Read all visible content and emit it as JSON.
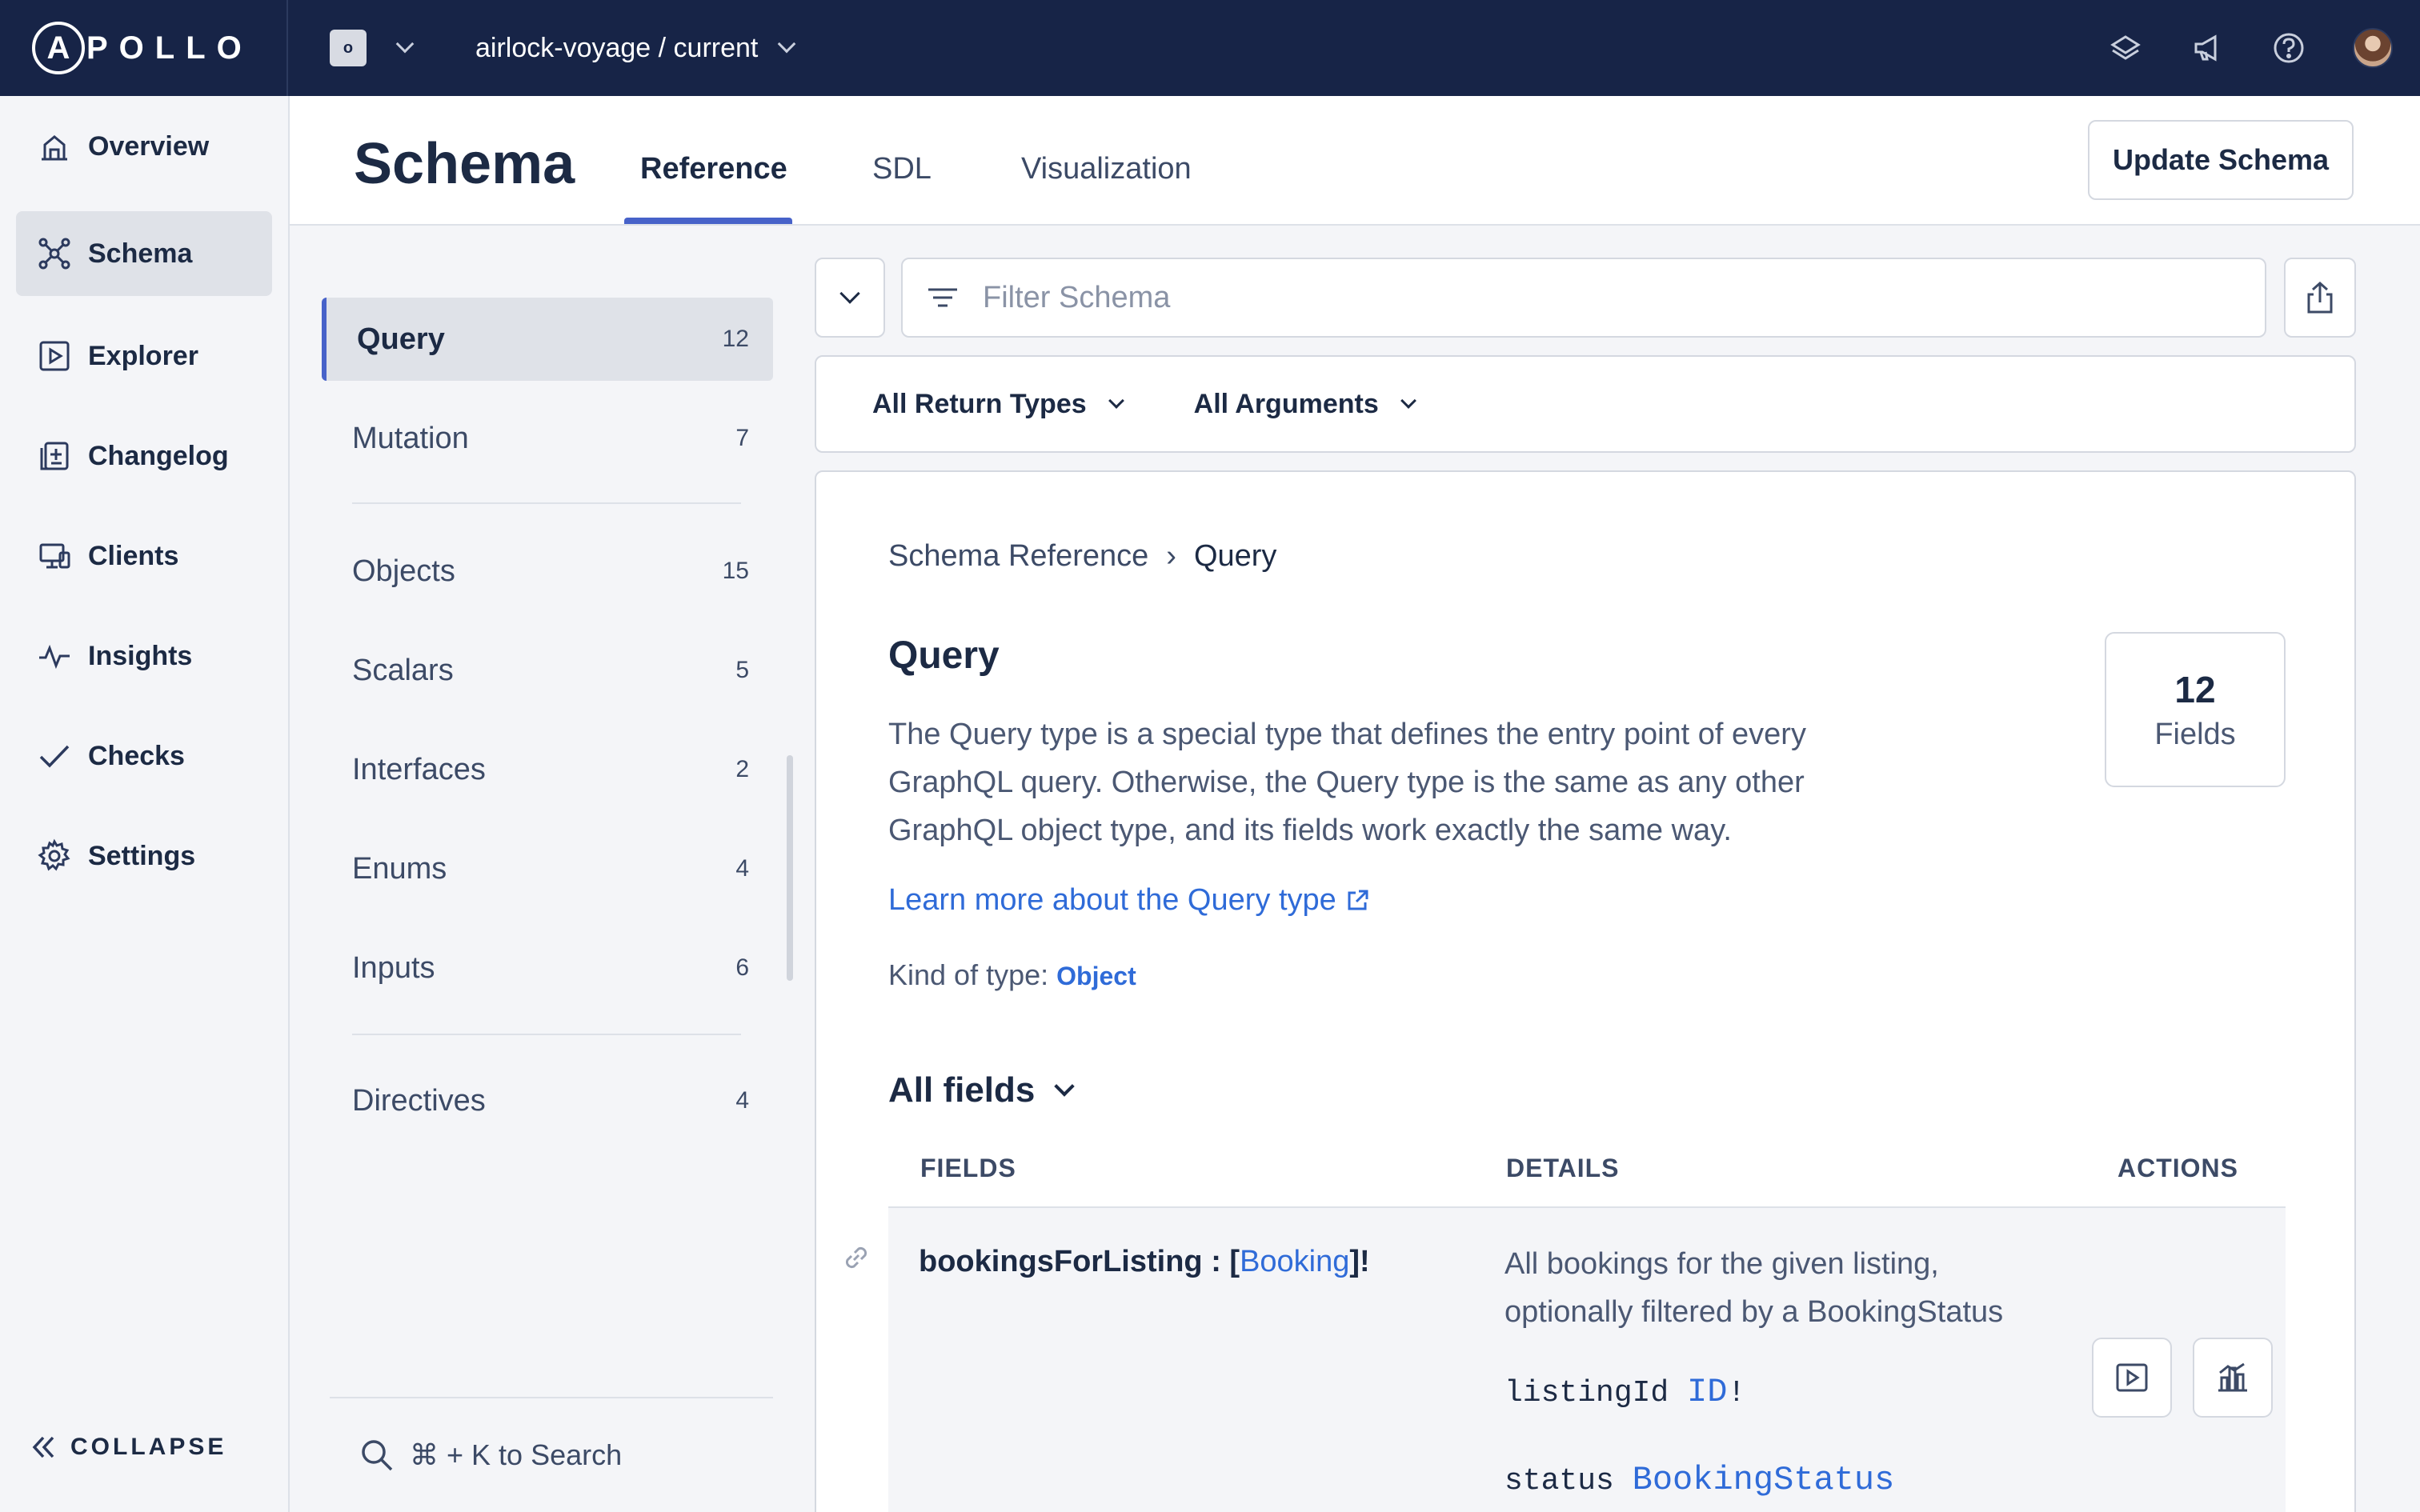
{
  "topbar": {
    "logo_letter": "A",
    "logo_text": "POLLO",
    "org_initial": "o",
    "graph_variant": "airlock-voyage / current"
  },
  "sidebar": {
    "items": [
      {
        "label": "Overview",
        "icon": "overview-icon"
      },
      {
        "label": "Schema",
        "icon": "schema-icon",
        "active": true
      },
      {
        "label": "Explorer",
        "icon": "explorer-icon"
      },
      {
        "label": "Changelog",
        "icon": "changelog-icon"
      },
      {
        "label": "Clients",
        "icon": "clients-icon"
      },
      {
        "label": "Insights",
        "icon": "insights-icon"
      },
      {
        "label": "Checks",
        "icon": "checks-icon"
      },
      {
        "label": "Settings",
        "icon": "settings-icon"
      }
    ],
    "collapse_label": "COLLAPSE"
  },
  "header": {
    "title": "Schema",
    "tabs": [
      {
        "label": "Reference",
        "active": true
      },
      {
        "label": "SDL"
      },
      {
        "label": "Visualization"
      }
    ],
    "update_button": "Update Schema"
  },
  "types": [
    {
      "name": "Query",
      "count": "12",
      "active": true
    },
    {
      "name": "Mutation",
      "count": "7"
    },
    {
      "name": "Objects",
      "count": "15"
    },
    {
      "name": "Scalars",
      "count": "5"
    },
    {
      "name": "Interfaces",
      "count": "2"
    },
    {
      "name": "Enums",
      "count": "4"
    },
    {
      "name": "Inputs",
      "count": "6"
    },
    {
      "name": "Directives",
      "count": "4"
    }
  ],
  "search_hint": "⌘ + K to Search",
  "filter": {
    "placeholder": "Filter Schema",
    "value": "",
    "return_types": "All Return Types",
    "arguments": "All Arguments"
  },
  "detail": {
    "breadcrumb_root": "Schema Reference",
    "breadcrumb_sep": "›",
    "breadcrumb_current": "Query",
    "title": "Query",
    "description": "The Query type is a special type that defines the entry point of every GraphQL query. Otherwise, the Query type is the same as any other GraphQL object type, and its fields work exactly the same way.",
    "learn_more": "Learn more about the Query type",
    "kind_label": "Kind of type:",
    "kind_value": "Object",
    "fields_count": "12",
    "fields_label": "Fields",
    "all_fields_label": "All fields",
    "columns": {
      "fields": "FIELDS",
      "details": "DETAILS",
      "actions": "ACTIONS"
    },
    "row": {
      "field_name": "bookingsForListing : [",
      "field_type": "Booking",
      "field_suffix": "]!",
      "description": "All bookings for the given listing, optionally filtered by a BookingStatus",
      "arg1_name": "listingId",
      "arg1_type": "ID",
      "arg1_suffix": "!",
      "arg2_name": "status",
      "arg2_type": "BookingStatus"
    }
  },
  "colors": {
    "topbar": "#172447",
    "accent": "#4762c9",
    "link": "#2f6bd8"
  }
}
